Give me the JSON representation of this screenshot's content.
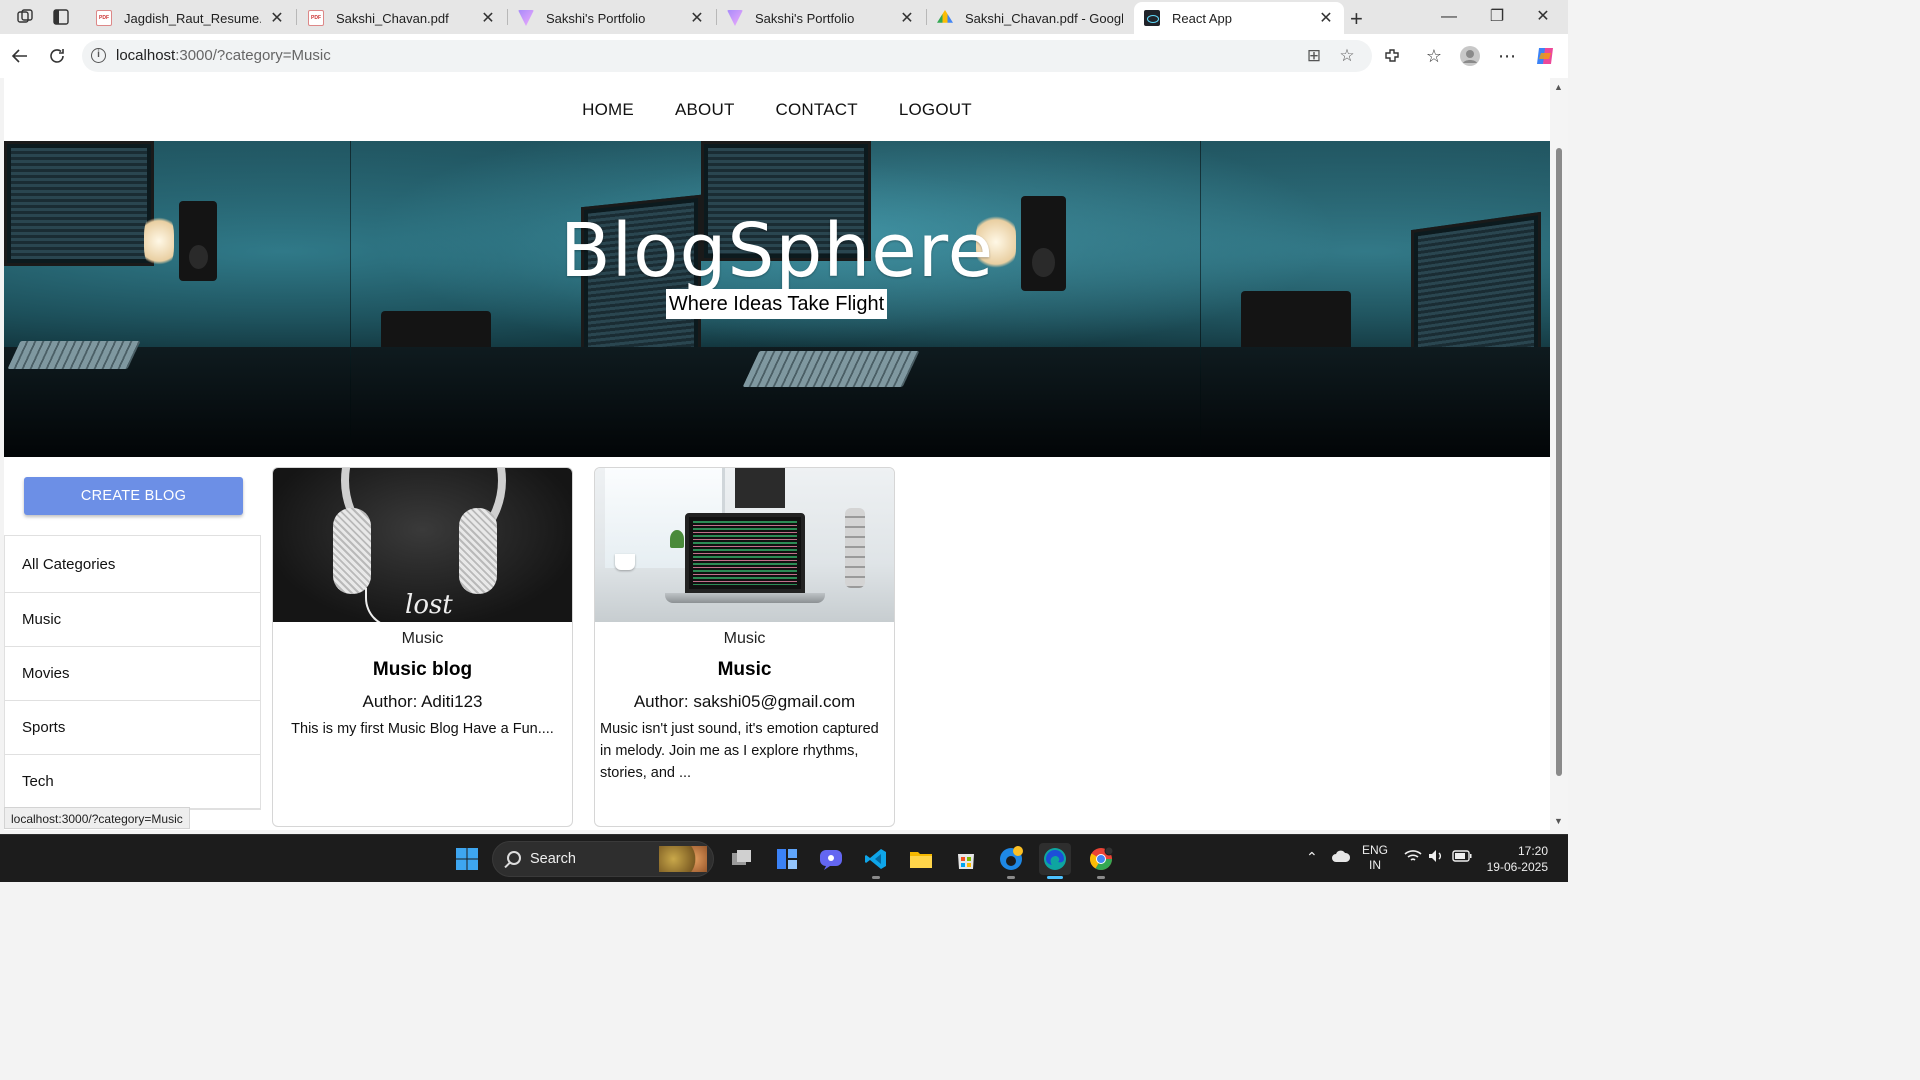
{
  "browser": {
    "tabs": [
      {
        "label": "Jagdish_Raut_Resume.pdf",
        "icon": "pdf-icon",
        "active": false
      },
      {
        "label": "Sakshi_Chavan.pdf",
        "icon": "pdf-icon",
        "active": false
      },
      {
        "label": "Sakshi's Portfolio",
        "icon": "vercel-v-icon",
        "active": false
      },
      {
        "label": "Sakshi's Portfolio",
        "icon": "vercel-v-icon",
        "active": false
      },
      {
        "label": "Sakshi_Chavan.pdf - Googl",
        "icon": "google-drive-icon",
        "active": false
      },
      {
        "label": "React App",
        "icon": "react-icon",
        "active": true
      }
    ],
    "url_host": "localhost",
    "url_rest": ":3000/?category=Music",
    "status_url": "localhost:3000/?category=Music"
  },
  "site": {
    "nav": [
      "HOME",
      "ABOUT",
      "CONTACT",
      "LOGOUT"
    ],
    "hero_title": "BlogSphere",
    "hero_subtitle": "Where Ideas Take Flight",
    "create_button": "CREATE BLOG",
    "categories": [
      "All Categories",
      "Music",
      "Movies",
      "Sports",
      "Tech"
    ],
    "posts": [
      {
        "category": "Music",
        "title": "Music blog",
        "author": "Author: Aditi123",
        "description": "This is my first Music Blog Have a Fun....",
        "image_text": "lost"
      },
      {
        "category": "Music",
        "title": "Music",
        "author": "Author: sakshi05@gmail.com",
        "description": "Music isn't just sound, it's emotion captured in melody. Join me as I explore rhythms, stories, and ..."
      }
    ]
  },
  "taskbar": {
    "search_label": "Search",
    "language": "ENG",
    "region": "IN",
    "time": "17:20",
    "date": "19-06-2025"
  },
  "colors": {
    "create_button": "#6c8fe6",
    "taskbar_bg": "#1c1c1c",
    "active_indicator": "#4cc2ff"
  }
}
